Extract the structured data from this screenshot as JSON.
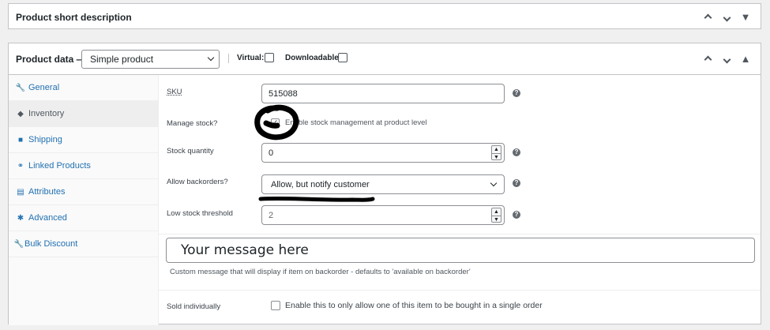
{
  "short_desc": {
    "title": "Product short description"
  },
  "product_data": {
    "title": "Product data —",
    "type_select": "Simple product",
    "virtual_label": "Virtual:",
    "downloadable_label": "Downloadable:"
  },
  "tabs": [
    {
      "label": "General",
      "icon": "wrench-icon",
      "glyph": "🔧"
    },
    {
      "label": "Inventory",
      "icon": "tag-icon",
      "glyph": "◆"
    },
    {
      "label": "Shipping",
      "icon": "truck-icon",
      "glyph": "■"
    },
    {
      "label": "Linked Products",
      "icon": "link-icon",
      "glyph": "⚭"
    },
    {
      "label": "Attributes",
      "icon": "list-icon",
      "glyph": "▤"
    },
    {
      "label": "Advanced",
      "icon": "gear-icon",
      "glyph": "✱"
    },
    {
      "label": "Bulk Discount",
      "icon": "wrench-icon",
      "glyph": "🔧"
    }
  ],
  "inventory": {
    "sku_label": "SKU",
    "sku_value": "515088",
    "manage_stock_label": "Manage stock?",
    "manage_stock_desc": "Enable stock management at product level",
    "stock_qty_label": "Stock quantity",
    "stock_qty_value": "0",
    "backorders_label": "Allow backorders?",
    "backorders_value": "Allow, but notify customer",
    "low_stock_label": "Low stock threshold",
    "low_stock_placeholder": "2",
    "message_value": "Your message here",
    "message_desc": "Custom message that will display if item on backorder - defaults to 'available on backorder'",
    "sold_individually_label": "Sold individually",
    "sold_individually_desc": "Enable this to only allow one of this item to be bought in a single order"
  },
  "colors": {
    "link": "#2271b1",
    "border": "#c3c4c7",
    "annotation": "#000000"
  }
}
